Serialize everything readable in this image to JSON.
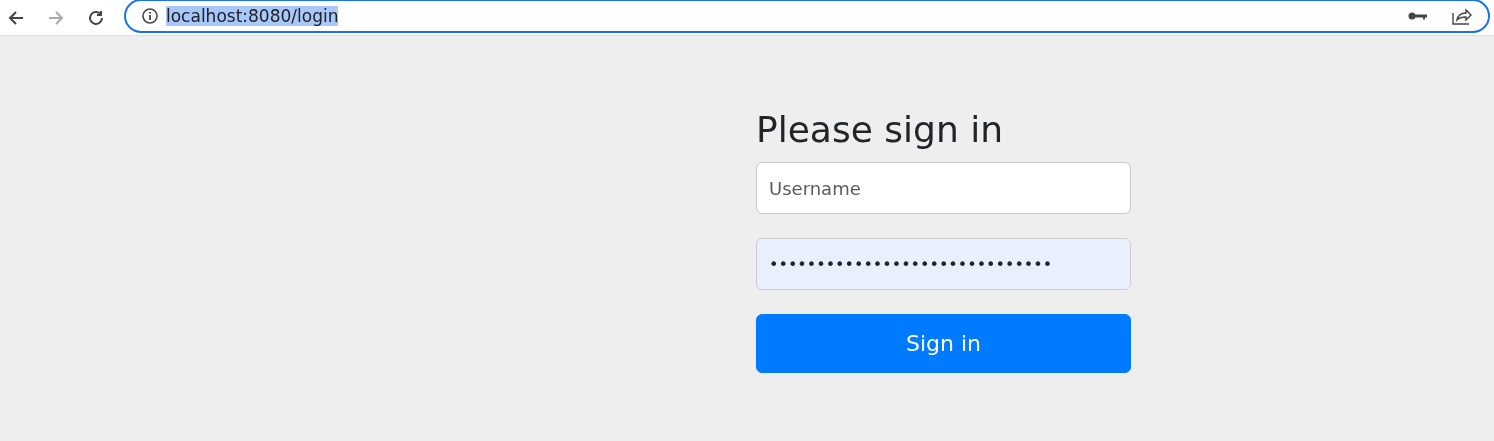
{
  "browser": {
    "url": "localhost:8080/login",
    "url_selected": true,
    "forward_disabled": true
  },
  "form": {
    "title": "Please sign in",
    "username": {
      "placeholder": "Username"
    },
    "password": {
      "value": "••••••••••••••••••••••••••••••",
      "autofilled": true
    },
    "submit": "Sign in"
  }
}
